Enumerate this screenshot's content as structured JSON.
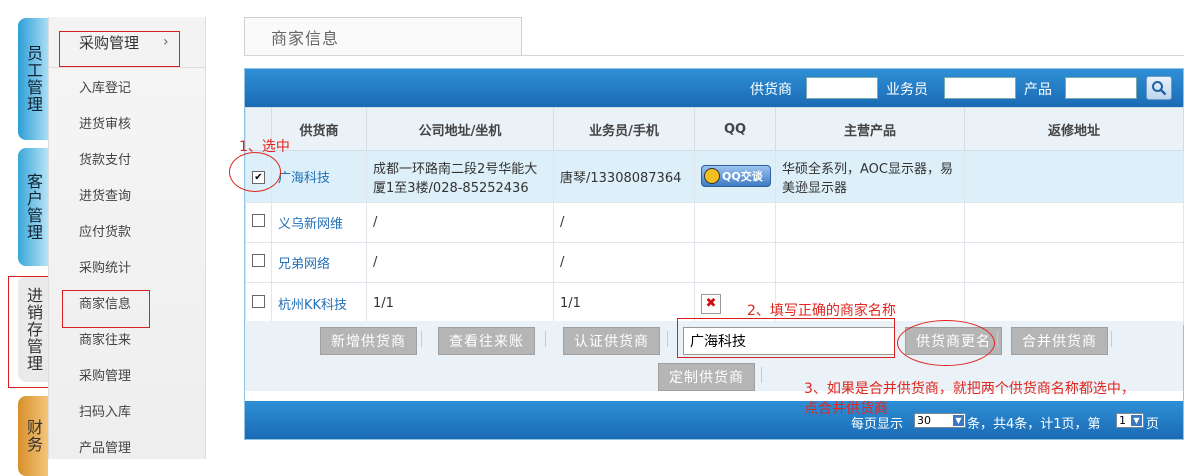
{
  "nav_tabs": [
    "员工管理",
    "客户管理",
    "进销存管理",
    "财务"
  ],
  "submenu": {
    "header": "采购管理",
    "chevron": "›",
    "items": [
      "入库登记",
      "进货审核",
      "货款支付",
      "进货查询",
      "应付货款",
      "采购统计",
      "商家信息",
      "商家往来",
      "采购管理",
      "扫码入库",
      "产品管理"
    ]
  },
  "page_tab": "商家信息",
  "search": {
    "supplier_label": "供货商",
    "salesman_label": "业务员",
    "product_label": "产品",
    "supplier_value": "",
    "salesman_value": "",
    "product_value": ""
  },
  "table": {
    "columns": [
      "",
      "供货商",
      "公司地址/坐机",
      "业务员/手机",
      "QQ",
      "主营产品",
      "返修地址"
    ],
    "rows": [
      {
        "checked": "✔",
        "name": "广海科技",
        "address": "成都一环路南二段2号华能大厦1至3楼/028-85252436",
        "contact": "唐琴/13308087364",
        "qq": "QQ交谈",
        "products": "华硕全系列，AOC显示器，易美逊显示器",
        "repair": ""
      },
      {
        "checked": "",
        "name": "义乌新网维",
        "address": "/",
        "contact": "/",
        "qq": "",
        "products": "",
        "repair": ""
      },
      {
        "checked": "",
        "name": "兄弟网络",
        "address": "/",
        "contact": "/",
        "qq": "",
        "products": "",
        "repair": ""
      },
      {
        "checked": "",
        "name": "杭州KK科技",
        "address": "1/1",
        "contact": "1/1",
        "qq": "✖",
        "products": "",
        "repair": ""
      }
    ]
  },
  "actions": {
    "add_supplier": "新增供货商",
    "view_accounts": "查看往来账",
    "certify_supplier": "认证供货商",
    "rename_value": "广海科技",
    "rename_supplier": "供货商更名",
    "merge_supplier": "合并供货商",
    "custom_supplier": "定制供货商"
  },
  "pagination": {
    "per_page_label": "每页显示",
    "per_page_value": "30",
    "summary": "条，共4条，计1页，第",
    "page_value": "1",
    "page_suffix": "页"
  },
  "annotations": {
    "step1": "1、选中",
    "step2": "2、填写正确的商家名称",
    "step3_line1": "3、如果是合并供货商，就把两个供货商名称都选中，",
    "step3_line2": "点合并供货商"
  },
  "colors": {
    "accent_blue": "#1a6bb4",
    "annotation_red": "#e0261f",
    "button_gray": "#b5b5b5"
  }
}
